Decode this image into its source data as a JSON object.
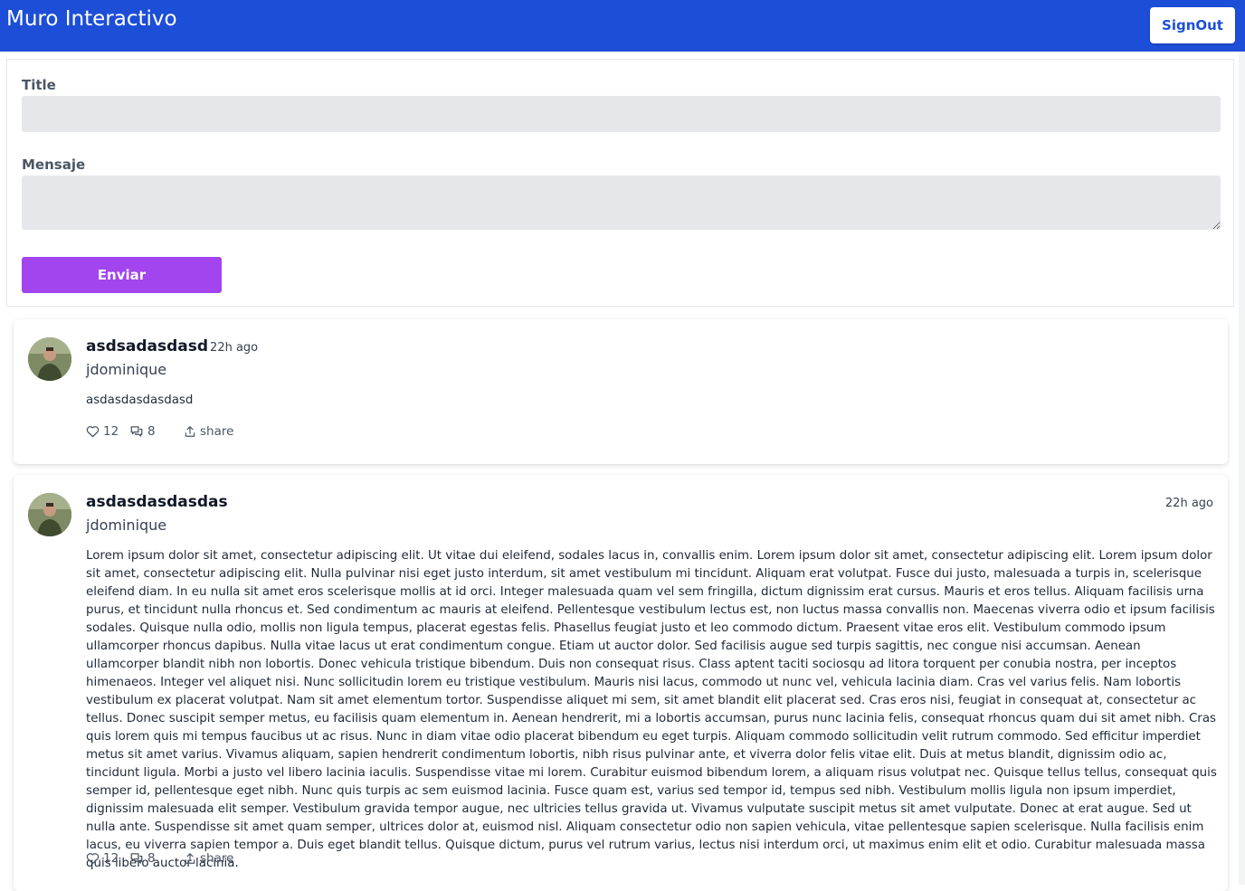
{
  "app": {
    "title": "Muro Interactivo",
    "signout_label": "SignOut"
  },
  "form": {
    "title_label": "Title",
    "title_value": "",
    "message_label": "Mensaje",
    "message_value": "",
    "submit_label": "Enviar"
  },
  "posts": [
    {
      "title": "asdsadasdasd",
      "time": "22h ago",
      "user": "jdominique",
      "body": "asdasdasdasdasd",
      "likes": "12",
      "comments": "8",
      "share_label": "share"
    },
    {
      "title": "asdasdasdasdas",
      "time": "22h ago",
      "user": "jdominique",
      "body": "Lorem ipsum dolor sit amet, consectetur adipiscing elit. Ut vitae dui eleifend, sodales lacus in, convallis enim. Lorem ipsum dolor sit amet, consectetur adipiscing elit. Lorem ipsum dolor sit amet, consectetur adipiscing elit. Nulla pulvinar nisi eget justo interdum, sit amet vestibulum mi tincidunt. Aliquam erat volutpat. Fusce dui justo, malesuada a turpis in, scelerisque eleifend diam. In eu nulla sit amet eros scelerisque mollis at id orci. Integer malesuada quam vel sem fringilla, dictum dignissim erat cursus. Mauris et eros tellus. Aliquam facilisis urna purus, et tincidunt nulla rhoncus et. Sed condimentum ac mauris at eleifend. Pellentesque vestibulum lectus est, non luctus massa convallis non. Maecenas viverra odio et ipsum facilisis sodales. Quisque nulla odio, mollis non ligula tempus, placerat egestas felis. Phasellus feugiat justo et leo commodo dictum. Praesent vitae eros elit. Vestibulum commodo ipsum ullamcorper rhoncus dapibus. Nulla vitae lacus ut erat condimentum congue. Etiam ut auctor dolor. Sed facilisis augue sed turpis sagittis, nec congue nisi accumsan. Aenean ullamcorper blandit nibh non lobortis. Donec vehicula tristique bibendum. Duis non consequat risus. Class aptent taciti sociosqu ad litora torquent per conubia nostra, per inceptos himenaeos. Integer vel aliquet nisi. Nunc sollicitudin lorem eu tristique vestibulum. Mauris nisi lacus, commodo ut nunc vel, vehicula lacinia diam. Cras vel varius felis. Nam lobortis vestibulum ex placerat volutpat. Nam sit amet elementum tortor. Suspendisse aliquet mi sem, sit amet blandit elit placerat sed. Cras eros nisi, feugiat in consequat at, consectetur ac tellus. Donec suscipit semper metus, eu facilisis quam elementum in. Aenean hendrerit, mi a lobortis accumsan, purus nunc lacinia felis, consequat rhoncus quam dui sit amet nibh. Cras quis lorem quis mi tempus faucibus ut ac risus. Nunc in diam vitae odio placerat bibendum eu eget turpis. Aliquam commodo sollicitudin velit rutrum commodo. Sed efficitur imperdiet metus sit amet varius. Vivamus aliquam, sapien hendrerit condimentum lobortis, nibh risus pulvinar ante, et viverra dolor felis vitae elit. Duis at metus blandit, dignissim odio ac, tincidunt ligula. Morbi a justo vel libero lacinia iaculis. Suspendisse vitae mi lorem. Curabitur euismod bibendum lorem, a aliquam risus volutpat nec. Quisque tellus tellus, consequat quis semper id, pellentesque eget nibh. Nunc quis turpis ac sem euismod lacinia. Fusce quam est, varius sed tempor id, tempus sed nibh. Vestibulum mollis ligula non ipsum imperdiet, dignissim malesuada elit semper. Vestibulum gravida tempor augue, nec ultricies tellus gravida ut. Vivamus vulputate suscipit metus sit amet vulputate. Donec at erat augue. Sed ut nulla ante. Suspendisse sit amet quam semper, ultrices dolor at, euismod nisl. Aliquam consectetur odio non sapien vehicula, vitae pellentesque sapien scelerisque. Nulla facilisis enim lacus, eu viverra sapien tempor a. Duis eget blandit tellus. Quisque dictum, purus vel rutrum varius, lectus nisi interdum orci, ut maximus enim elit et odio. Curabitur malesuada massa quis libero auctor lacinia.",
      "likes": "12",
      "comments": "8",
      "share_label": "share"
    }
  ],
  "colors": {
    "header": "#1d4ed8",
    "submit": "#a245ee",
    "field_bg": "#e5e7eb"
  },
  "icons": [
    "heart-icon",
    "comment-icon",
    "share-icon",
    "avatar"
  ]
}
